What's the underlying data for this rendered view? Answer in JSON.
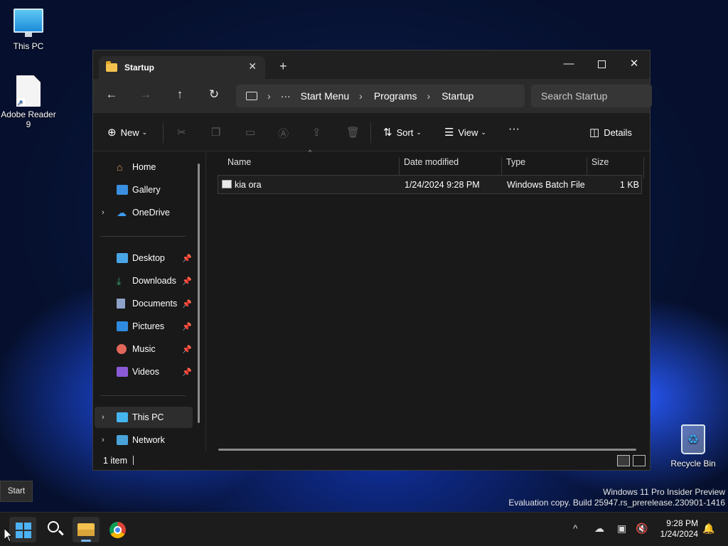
{
  "desktop": {
    "icons": [
      {
        "label": "This PC",
        "icon": "this-pc-icon"
      },
      {
        "label": "Adobe Reader 9",
        "icon": "pdf-shortcut-icon"
      },
      {
        "label": "Recycle Bin",
        "icon": "recycle-bin-icon"
      }
    ],
    "tooltip": "Start",
    "watermark_line1": "Windows 11 Pro Insider Preview",
    "watermark_line2": "Evaluation copy. Build 25947.rs_prerelease.230901-1416"
  },
  "window": {
    "tab_title": "Startup",
    "tab_close": "✕",
    "new_tab": "+",
    "controls": {
      "minimize": "—",
      "close": "✕"
    },
    "nav": {
      "back": "←",
      "forward": "→",
      "up": "↑",
      "refresh": "↻"
    },
    "breadcrumb": {
      "more": "···",
      "items": [
        "Start Menu",
        "Programs",
        "Startup"
      ],
      "separator": "›"
    },
    "search_placeholder": "Search Startup",
    "commands": {
      "new": "New",
      "sort": "Sort",
      "view": "View",
      "more": "···",
      "details": "Details"
    },
    "sidebar": {
      "items": [
        {
          "label": "Home",
          "icon": "home-icon"
        },
        {
          "label": "Gallery",
          "icon": "gallery-icon"
        },
        {
          "label": "OneDrive",
          "icon": "onedrive-icon"
        },
        {
          "label": "Desktop",
          "icon": "desktop-folder-icon"
        },
        {
          "label": "Downloads",
          "icon": "downloads-icon"
        },
        {
          "label": "Documents",
          "icon": "documents-icon"
        },
        {
          "label": "Pictures",
          "icon": "pictures-icon"
        },
        {
          "label": "Music",
          "icon": "music-icon"
        },
        {
          "label": "Videos",
          "icon": "videos-icon"
        },
        {
          "label": "This PC",
          "icon": "this-pc-icon"
        },
        {
          "label": "Network",
          "icon": "network-icon"
        }
      ]
    },
    "columns": [
      "Name",
      "Date modified",
      "Type",
      "Size"
    ],
    "files": [
      {
        "name": "kia ora",
        "date": "1/24/2024 9:28 PM",
        "type": "Windows Batch File",
        "size": "1 KB"
      }
    ],
    "status": "1 item"
  },
  "taskbar": {
    "time": "9:28 PM",
    "date": "1/24/2024",
    "tray_overflow": "^"
  }
}
